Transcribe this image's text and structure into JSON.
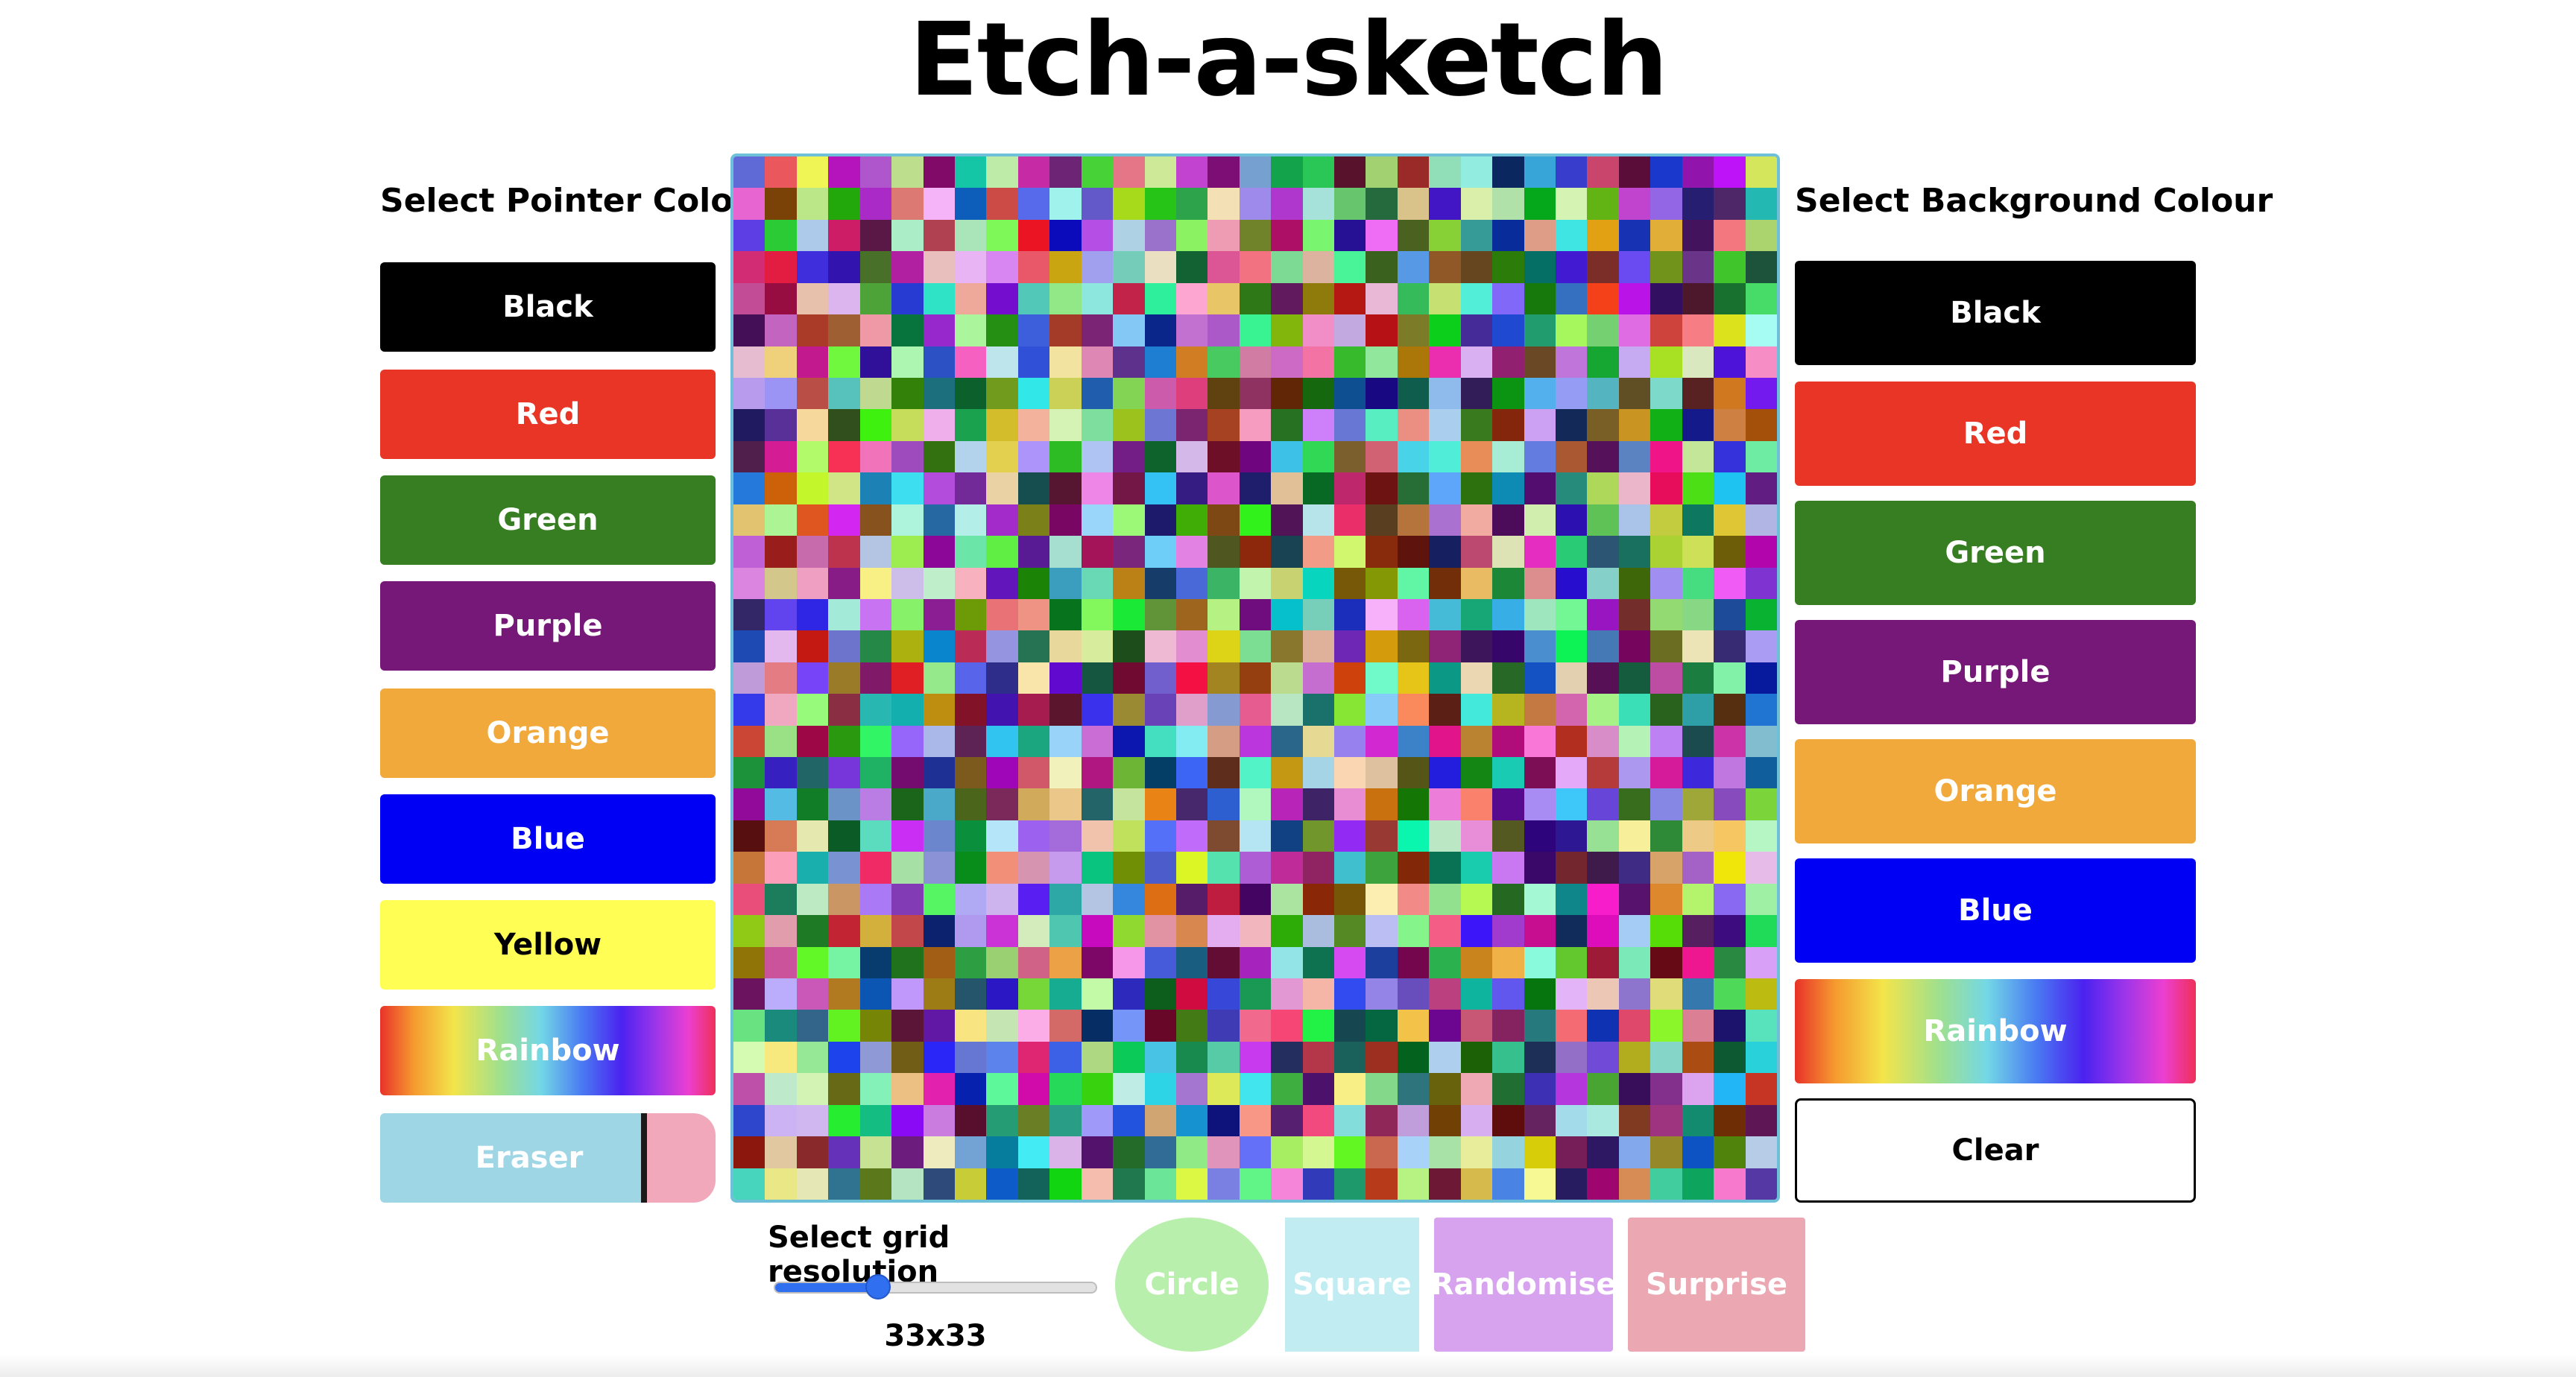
{
  "title": "Etch-a-sketch",
  "pointer_panel": {
    "heading": "Select Pointer Colour",
    "buttons": [
      {
        "label": "Black",
        "color": "#000000",
        "text_color": "#ffffff"
      },
      {
        "label": "Red",
        "color": "#e83526",
        "text_color": "#ffffff"
      },
      {
        "label": "Green",
        "color": "#377e22",
        "text_color": "#ffffff"
      },
      {
        "label": "Purple",
        "color": "#761877",
        "text_color": "#ffffff"
      },
      {
        "label": "Orange",
        "color": "#f1a93c",
        "text_color": "#ffffff"
      },
      {
        "label": "Blue",
        "color": "#0000f5",
        "text_color": "#ffffff"
      },
      {
        "label": "Yellow",
        "color": "#fffe54",
        "text_color": "#000000"
      },
      {
        "label": "Rainbow",
        "color": "rainbow",
        "text_color": "#ffffff"
      },
      {
        "label": "Eraser",
        "color": "#9fd6e6",
        "text_color": "#ffffff"
      }
    ]
  },
  "background_panel": {
    "heading": "Select Background Colour",
    "buttons": [
      {
        "label": "Black",
        "color": "#000000",
        "text_color": "#ffffff"
      },
      {
        "label": "Red",
        "color": "#e83526",
        "text_color": "#ffffff"
      },
      {
        "label": "Green",
        "color": "#377e22",
        "text_color": "#ffffff"
      },
      {
        "label": "Purple",
        "color": "#761877",
        "text_color": "#ffffff"
      },
      {
        "label": "Orange",
        "color": "#f1a93c",
        "text_color": "#ffffff"
      },
      {
        "label": "Blue",
        "color": "#0000f5",
        "text_color": "#ffffff"
      },
      {
        "label": "Rainbow",
        "color": "rainbow",
        "text_color": "#ffffff"
      },
      {
        "label": "Clear",
        "color": "#ffffff",
        "text_color": "#000000"
      }
    ]
  },
  "grid": {
    "size": 33,
    "border_color": "#6ec0d8",
    "palette": [
      "#e8322a",
      "#377e22",
      "#761877",
      "#f1a93c",
      "#0000f5",
      "#fffe54",
      "#9fe08e",
      "#73d7e6",
      "#4a7cf2",
      "#9b35ea",
      "#ec3fd0",
      "#5ac46a",
      "#c14a8a",
      "#2a2f6b",
      "#d6e46a",
      "#8c6a4e",
      "#4fb8c8",
      "#f2c2d4",
      "#1b1b1b",
      "#a3b35f",
      "#6a2a2a",
      "#c9b3e6",
      "#3a7a5e",
      "#e87a3a",
      "#b3e6f0",
      "#7a3ad6",
      "#d64a6a",
      "#e6d6a3",
      "#3a5ad6",
      "#6ae66a"
    ]
  },
  "resolution": {
    "label": "Select grid resolution",
    "value_text": "33x33",
    "value": 33,
    "min": 1,
    "max": 100
  },
  "shape_buttons": {
    "circle": "Circle",
    "square": "Square",
    "randomise": "Randomise",
    "surprise": "Surprise"
  }
}
